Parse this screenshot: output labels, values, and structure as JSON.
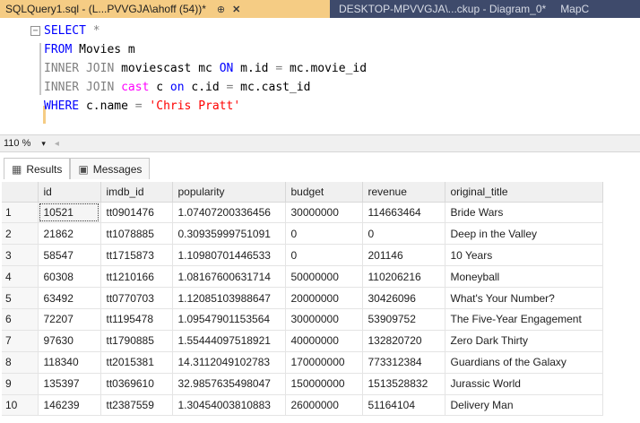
{
  "tabs": {
    "active_title": "SQLQuery1.sql - (L...PVVGJA\\ahoff (54))*",
    "pin_icon": "⊕",
    "close_icon": "✕",
    "second_title": "DESKTOP-MPVVGJA\\...ckup - Diagram_0*",
    "third_title": "MapC"
  },
  "editor": {
    "fold_icon": "−",
    "line1": {
      "kw1": "SELECT",
      "rest": " *"
    },
    "line2": {
      "kw1": "FROM",
      "rest": " Movies m"
    },
    "line3": {
      "kw1": "INNER JOIN",
      "t1": " moviescast mc ",
      "kw2": "ON",
      "t2": " m.id ",
      "op": "=",
      "t3": " mc.movie_id"
    },
    "line4": {
      "kw1": "INNER JOIN",
      "fn": " cast",
      "t1": " c ",
      "kw2": "on",
      "t2": " c.id ",
      "op": "=",
      "t3": " mc.cast_id"
    },
    "line5": {
      "kw1": "WHERE",
      "t1": " c.name ",
      "op": "=",
      "str": " 'Chris Pratt'"
    }
  },
  "zoom": {
    "value": "110 %",
    "arrow": "▾",
    "scroll": "◂"
  },
  "results_tabs": {
    "results_label": "Results",
    "messages_label": "Messages",
    "results_icon": "▦",
    "messages_icon": "▣"
  },
  "grid": {
    "columns": [
      "",
      "id",
      "imdb_id",
      "popularity",
      "budget",
      "revenue",
      "original_title"
    ],
    "rows": [
      [
        "1",
        "10521",
        "tt0901476",
        "1.07407200336456",
        "30000000",
        "114663464",
        "Bride Wars"
      ],
      [
        "2",
        "21862",
        "tt1078885",
        "0.30935999751091",
        "0",
        "0",
        "Deep in the Valley"
      ],
      [
        "3",
        "58547",
        "tt1715873",
        "1.10980701446533",
        "0",
        "201146",
        "10 Years"
      ],
      [
        "4",
        "60308",
        "tt1210166",
        "1.08167600631714",
        "50000000",
        "110206216",
        "Moneyball"
      ],
      [
        "5",
        "63492",
        "tt0770703",
        "1.12085103988647",
        "20000000",
        "30426096",
        "What's Your Number?"
      ],
      [
        "6",
        "72207",
        "tt1195478",
        "1.09547901153564",
        "30000000",
        "53909752",
        "The Five-Year Engagement"
      ],
      [
        "7",
        "97630",
        "tt1790885",
        "1.55444097518921",
        "40000000",
        "132820720",
        "Zero Dark Thirty"
      ],
      [
        "8",
        "118340",
        "tt2015381",
        "14.3112049102783",
        "170000000",
        "773312384",
        "Guardians of the Galaxy"
      ],
      [
        "9",
        "135397",
        "tt0369610",
        "32.9857635498047",
        "150000000",
        "1513528832",
        "Jurassic World"
      ],
      [
        "10",
        "146239",
        "tt2387559",
        "1.30454003810883",
        "26000000",
        "51164104",
        "Delivery Man"
      ]
    ]
  }
}
